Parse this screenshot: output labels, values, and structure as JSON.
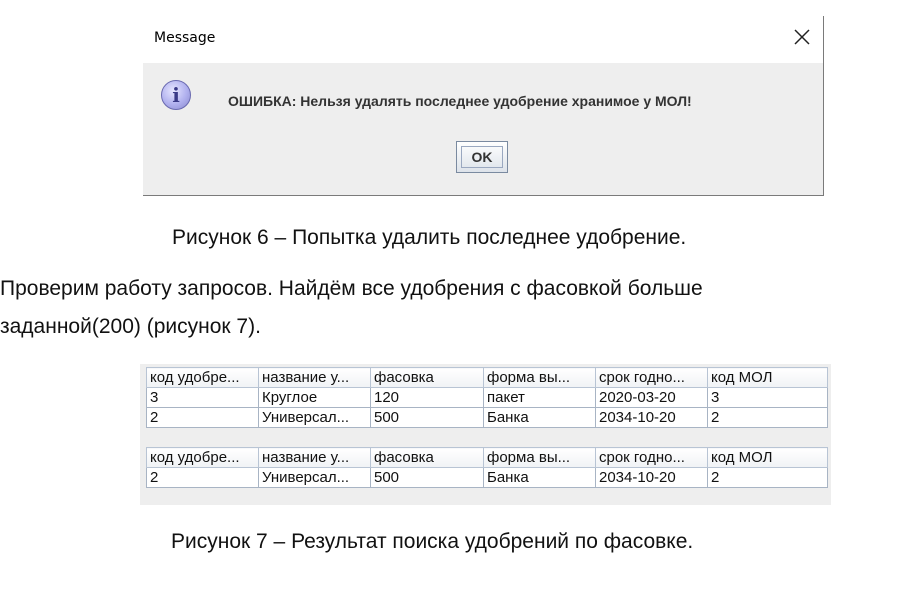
{
  "dialog": {
    "title": "Message",
    "message": "ОШИБКА: Нельзя удалять последнее удобрение хранимое у МОЛ!",
    "ok_label": "OK",
    "icon": "info-icon",
    "icon_glyph": "i",
    "close_glyph": "×"
  },
  "captions": {
    "fig6": "Рисунок 6 – Попытка удалить последнее удобрение.",
    "fig7": "Рисунок 7 – Результат поиска удобрений по фасовке."
  },
  "paragraph": {
    "line1": "Проверим работу запросов. Найдём все удобрения с фасовкой больше",
    "line2": "заданной(200)  (рисунок 7)."
  },
  "table1": {
    "headers": [
      "код удобре...",
      "название у...",
      "фасовка",
      "форма вы...",
      "срок годно...",
      "код МОЛ"
    ],
    "rows": [
      [
        "3",
        "Круглое",
        "120",
        "пакет",
        "2020-03-20",
        "3"
      ],
      [
        "2",
        "Универсал...",
        "500",
        "Банка",
        "2034-10-20",
        "2"
      ]
    ]
  },
  "table2": {
    "headers": [
      "код удобре...",
      "название у...",
      "фасовка",
      "форма вы...",
      "срок годно...",
      "код МОЛ"
    ],
    "rows": [
      [
        "2",
        "Универсал...",
        "500",
        "Банка",
        "2034-10-20",
        "2"
      ]
    ]
  }
}
